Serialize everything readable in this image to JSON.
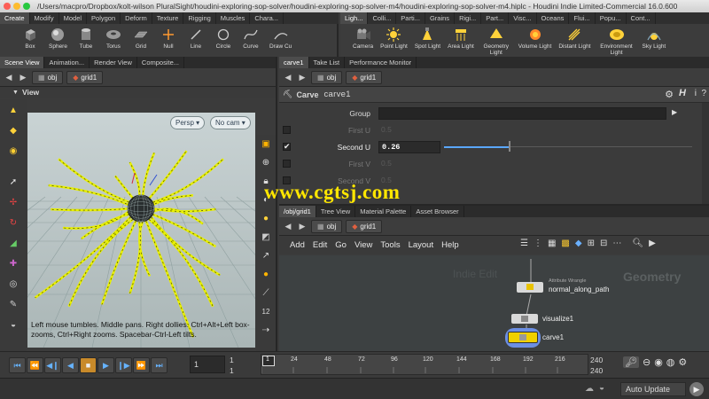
{
  "window_title": "/Users/macpro/Dropbox/kolt-wilson PluralSight/houdini-exploring-sop-solver/houdini-exploring-sop-solver-m4/houdini-exploring-sop-solver-m4.hiplc - Houdini Indie Limited-Commercial 16.0.600",
  "shelf_left": {
    "tabs": [
      "Create",
      "Modify",
      "Model",
      "Polygon",
      "Deform",
      "Texture",
      "Rigging",
      "Muscles",
      "Chara..."
    ],
    "tools": [
      "Box",
      "Sphere",
      "Tube",
      "Torus",
      "Grid",
      "Null",
      "Line",
      "Circle",
      "Curve",
      "Draw Cu"
    ]
  },
  "shelf_right": {
    "tabs": [
      "Ligh...",
      "Colli...",
      "Parti...",
      "Grains",
      "Rigi...",
      "Part...",
      "Visc...",
      "Oceans",
      "Flui...",
      "Popu...",
      "Cont..."
    ],
    "tools": [
      "Camera",
      "Point Light",
      "Spot Light",
      "Area Light",
      "Geometry Light",
      "Volume Light",
      "Distant Light",
      "Environment Light",
      "Sky Light"
    ]
  },
  "left_pane": {
    "tabs": [
      "Scene View",
      "Animation...",
      "Render View",
      "Composite..."
    ],
    "path": {
      "network": "obj",
      "node": "grid1"
    },
    "viewer_label": "View",
    "persp_button": "Persp",
    "cam_button": "No cam",
    "help_text": "Left mouse tumbles. Middle pans. Right dollies. Ctrl+Alt+Left box-zooms, Ctrl+Right zooms. Spacebar-Ctrl-Left tilts."
  },
  "param_pane": {
    "tabs": [
      "carve1",
      "Take List",
      "Performance Monitor"
    ],
    "path": {
      "network": "obj",
      "node": "grid1"
    },
    "node_type": "Carve",
    "node_name": "carve1",
    "params": [
      {
        "label": "Group",
        "value": ""
      },
      {
        "label": "First U",
        "value": "0.5"
      },
      {
        "label": "Second U",
        "value": "0.26"
      },
      {
        "label": "First V",
        "value": "0.5"
      },
      {
        "label": "Second V",
        "value": "0.5"
      }
    ],
    "h_label": "H",
    "info_label": "i",
    "help_label": "?"
  },
  "network_pane": {
    "tabs": [
      "/obj/grid1",
      "Tree View",
      "Material Palette",
      "Asset Browser"
    ],
    "path": {
      "network": "obj",
      "node": "grid1"
    },
    "menu": [
      "Add",
      "Edit",
      "Go",
      "View",
      "Tools",
      "Layout",
      "Help"
    ],
    "watermark": "Geometry",
    "faded_label": "Indie Edit",
    "nodes": [
      {
        "name": "normal_along_path",
        "subtitle": "Attribute Wrangle"
      },
      {
        "name": "visualize1",
        "subtitle": ""
      },
      {
        "name": "carve1",
        "subtitle": ""
      }
    ],
    "auto_update": "Auto Update"
  },
  "playbar": {
    "frame": "1",
    "start_frame": "1",
    "start_frame2": "1",
    "ticks": [
      "1",
      "24",
      "48",
      "72",
      "96",
      "120",
      "144",
      "168",
      "192",
      "216"
    ],
    "end_frame": "240",
    "end_frame2": "240"
  },
  "watermark_site": "www.cgtsj.com",
  "colors": {
    "accent_blue": "#5aa7ff",
    "yellow_curves": "#e8f000",
    "viewport_bg": "#b9c3c3",
    "node_selected": "#f0d000"
  }
}
